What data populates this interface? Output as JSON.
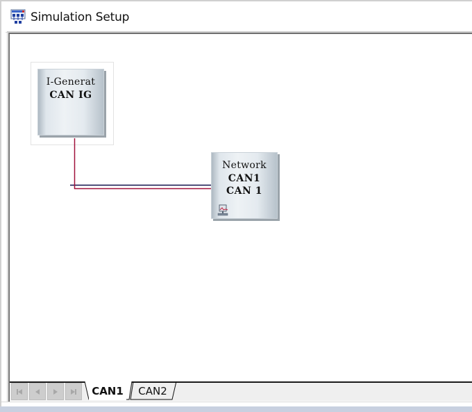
{
  "window": {
    "title": "Simulation Setup",
    "icon": "network-setup-icon"
  },
  "canvas": {
    "nodes": [
      {
        "id": "igen",
        "type": "I-Generator",
        "line1": "I-Generat",
        "line2": "CAN IG"
      },
      {
        "id": "network",
        "type": "Network",
        "line1": "Network",
        "line2": "CAN1",
        "line3": "CAN 1",
        "icon": "network-node-icon"
      }
    ],
    "connections": [
      {
        "from": "igen",
        "to": "network",
        "color": "#a0103a"
      },
      {
        "bus": "CAN1",
        "color": "#10104a"
      }
    ]
  },
  "tabs": {
    "nav": [
      {
        "name": "first-page",
        "glyph": "⏮"
      },
      {
        "name": "previous-page",
        "glyph": "◀"
      },
      {
        "name": "next-page",
        "glyph": "▶"
      },
      {
        "name": "last-page",
        "glyph": "⏭"
      }
    ],
    "items": [
      {
        "label": "CAN1",
        "active": true
      },
      {
        "label": "CAN2",
        "active": false
      }
    ]
  },
  "colors": {
    "wire_node": "#a0103a",
    "wire_bus": "#10104a",
    "node_shadow": "#9aa3aa"
  }
}
